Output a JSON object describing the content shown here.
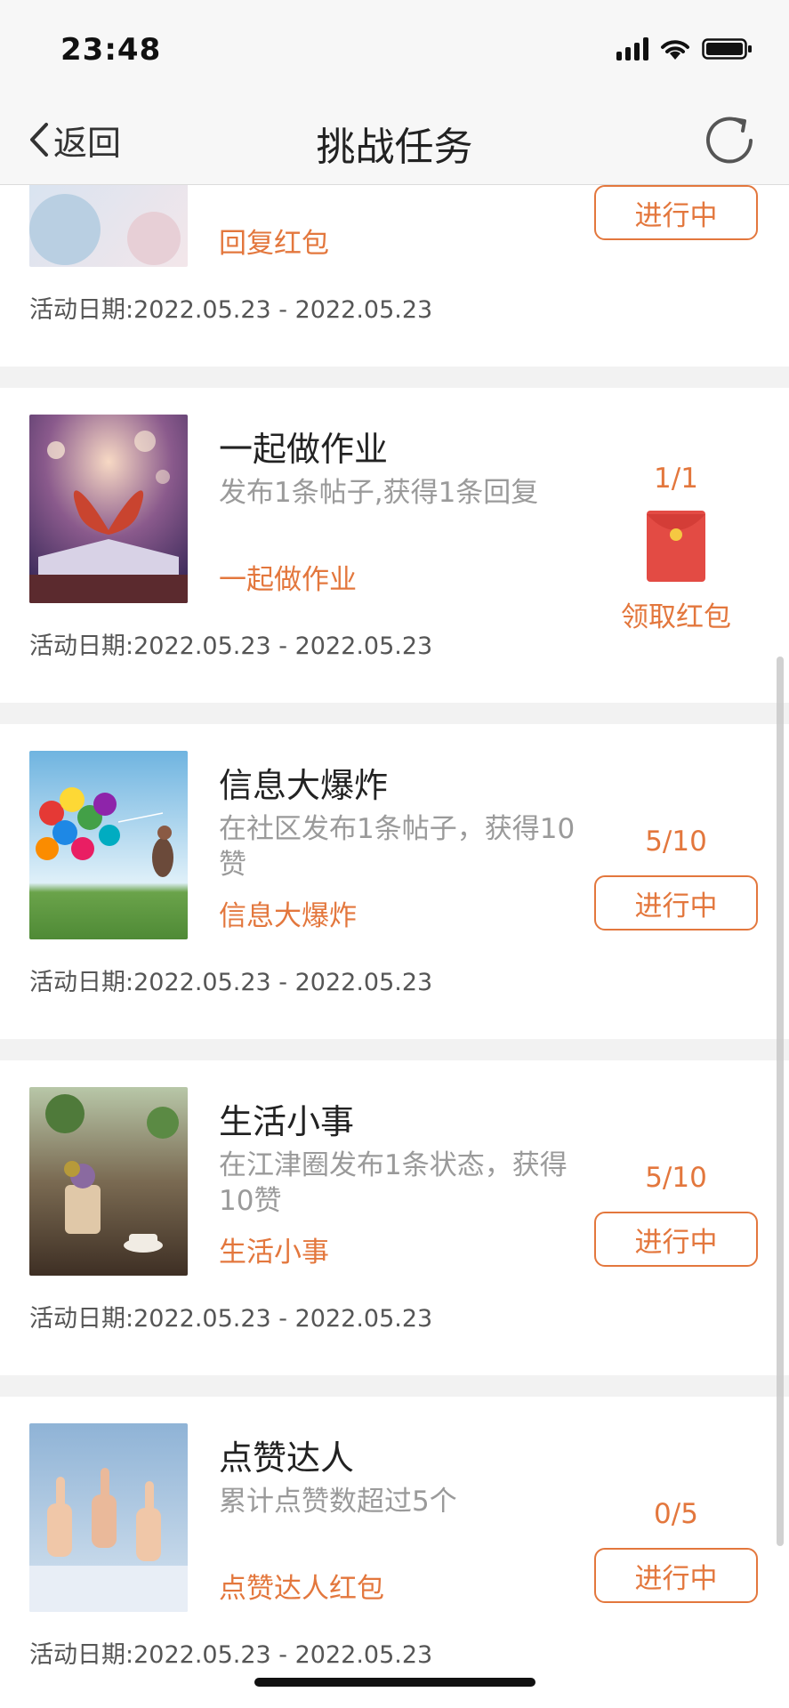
{
  "status_bar": {
    "time": "23:48"
  },
  "nav": {
    "back_label": "返回",
    "title": "挑战任务"
  },
  "tasks": [
    {
      "name": "",
      "desc": "",
      "reward": "回复红包",
      "date_label": "活动日期:",
      "date_range": "2022.05.23 - 2022.05.23",
      "status": "进行中"
    },
    {
      "name": "一起做作业",
      "desc": "发布1条帖子,获得1条回复",
      "reward": "一起做作业",
      "progress": "1/1",
      "action": "领取红包",
      "date_label": "活动日期:",
      "date_range": "2022.05.23 - 2022.05.23"
    },
    {
      "name": "信息大爆炸",
      "desc": "在社区发布1条帖子，获得10赞",
      "reward": "信息大爆炸",
      "progress": "5/10",
      "status": "进行中",
      "date_label": "活动日期:",
      "date_range": "2022.05.23 - 2022.05.23"
    },
    {
      "name": "生活小事",
      "desc": "在江津圈发布1条状态，获得10赞",
      "reward": "生活小事",
      "progress": "5/10",
      "status": "进行中",
      "date_label": "活动日期:",
      "date_range": "2022.05.23 - 2022.05.23"
    },
    {
      "name": "点赞达人",
      "desc": "累计点赞数超过5个",
      "reward": "点赞达人红包",
      "progress": "0/5",
      "status": "进行中",
      "date_label": "活动日期:",
      "date_range": "2022.05.23 - 2022.05.23"
    }
  ],
  "colors": {
    "accent": "#e3773d",
    "red_packet": "#e34b44",
    "nav_bg": "#f7f7f7"
  }
}
